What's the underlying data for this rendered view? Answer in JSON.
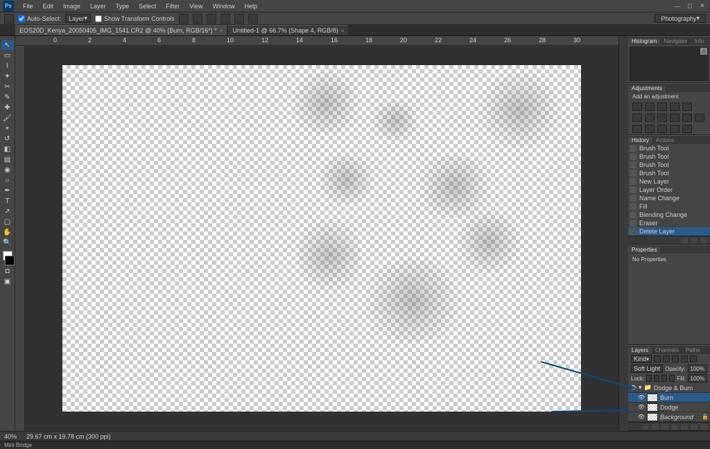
{
  "app": {
    "logo": "Ps"
  },
  "menu": [
    "File",
    "Edit",
    "Image",
    "Layer",
    "Type",
    "Select",
    "Filter",
    "View",
    "Window",
    "Help"
  ],
  "options": {
    "auto_select": "Auto-Select:",
    "auto_select_value": "Layer",
    "show_transform": "Show Transform Controls",
    "workspace": "Photography"
  },
  "tabs": [
    {
      "label": "EOS20D_Kenya_20050405_IMG_1541.CR2 @ 40% (Burn, RGB/16*) *"
    },
    {
      "label": "Untitled-1 @ 66.7% (Shape 4, RGB/8)"
    }
  ],
  "ruler_marks": [
    "0",
    "2",
    "4",
    "6",
    "8",
    "10",
    "12",
    "14",
    "16",
    "18",
    "20",
    "22",
    "24",
    "26",
    "28",
    "30"
  ],
  "status": {
    "zoom": "40%",
    "info": "29.67 cm x 19.78 cm (300 ppi)"
  },
  "minibridge": "Mini Bridge",
  "panels": {
    "hist_tabs": [
      "Histogram",
      "Navigator",
      "Info"
    ],
    "adj_tab": "Adjustments",
    "adj_hint": "Add an adjustment",
    "history_tabs": [
      "History",
      "Actions"
    ],
    "history": [
      "Brush Tool",
      "Brush Tool",
      "Brush Tool",
      "Brush Tool",
      "New Layer",
      "Layer Order",
      "Name Change",
      "Fill",
      "Blending Change",
      "Eraser",
      "Delete Layer"
    ],
    "history_sel": 10,
    "props_tab": "Properties",
    "props_msg": "No Properties",
    "layers_tabs": [
      "Layers",
      "Channels",
      "Paths"
    ],
    "layers_opts": {
      "kind": "Kind",
      "blend": "Soft Light",
      "opacity_label": "Opacity:",
      "opacity": "100%",
      "lock_label": "Lock:",
      "fill_label": "Fill:",
      "fill": "100%"
    },
    "layer_group": "Dodge & Burn",
    "layers": [
      {
        "name": "Burn",
        "sel": true,
        "locked": false
      },
      {
        "name": "Dodge",
        "sel": false,
        "locked": false
      },
      {
        "name": "Background",
        "sel": false,
        "locked": true
      }
    ]
  }
}
